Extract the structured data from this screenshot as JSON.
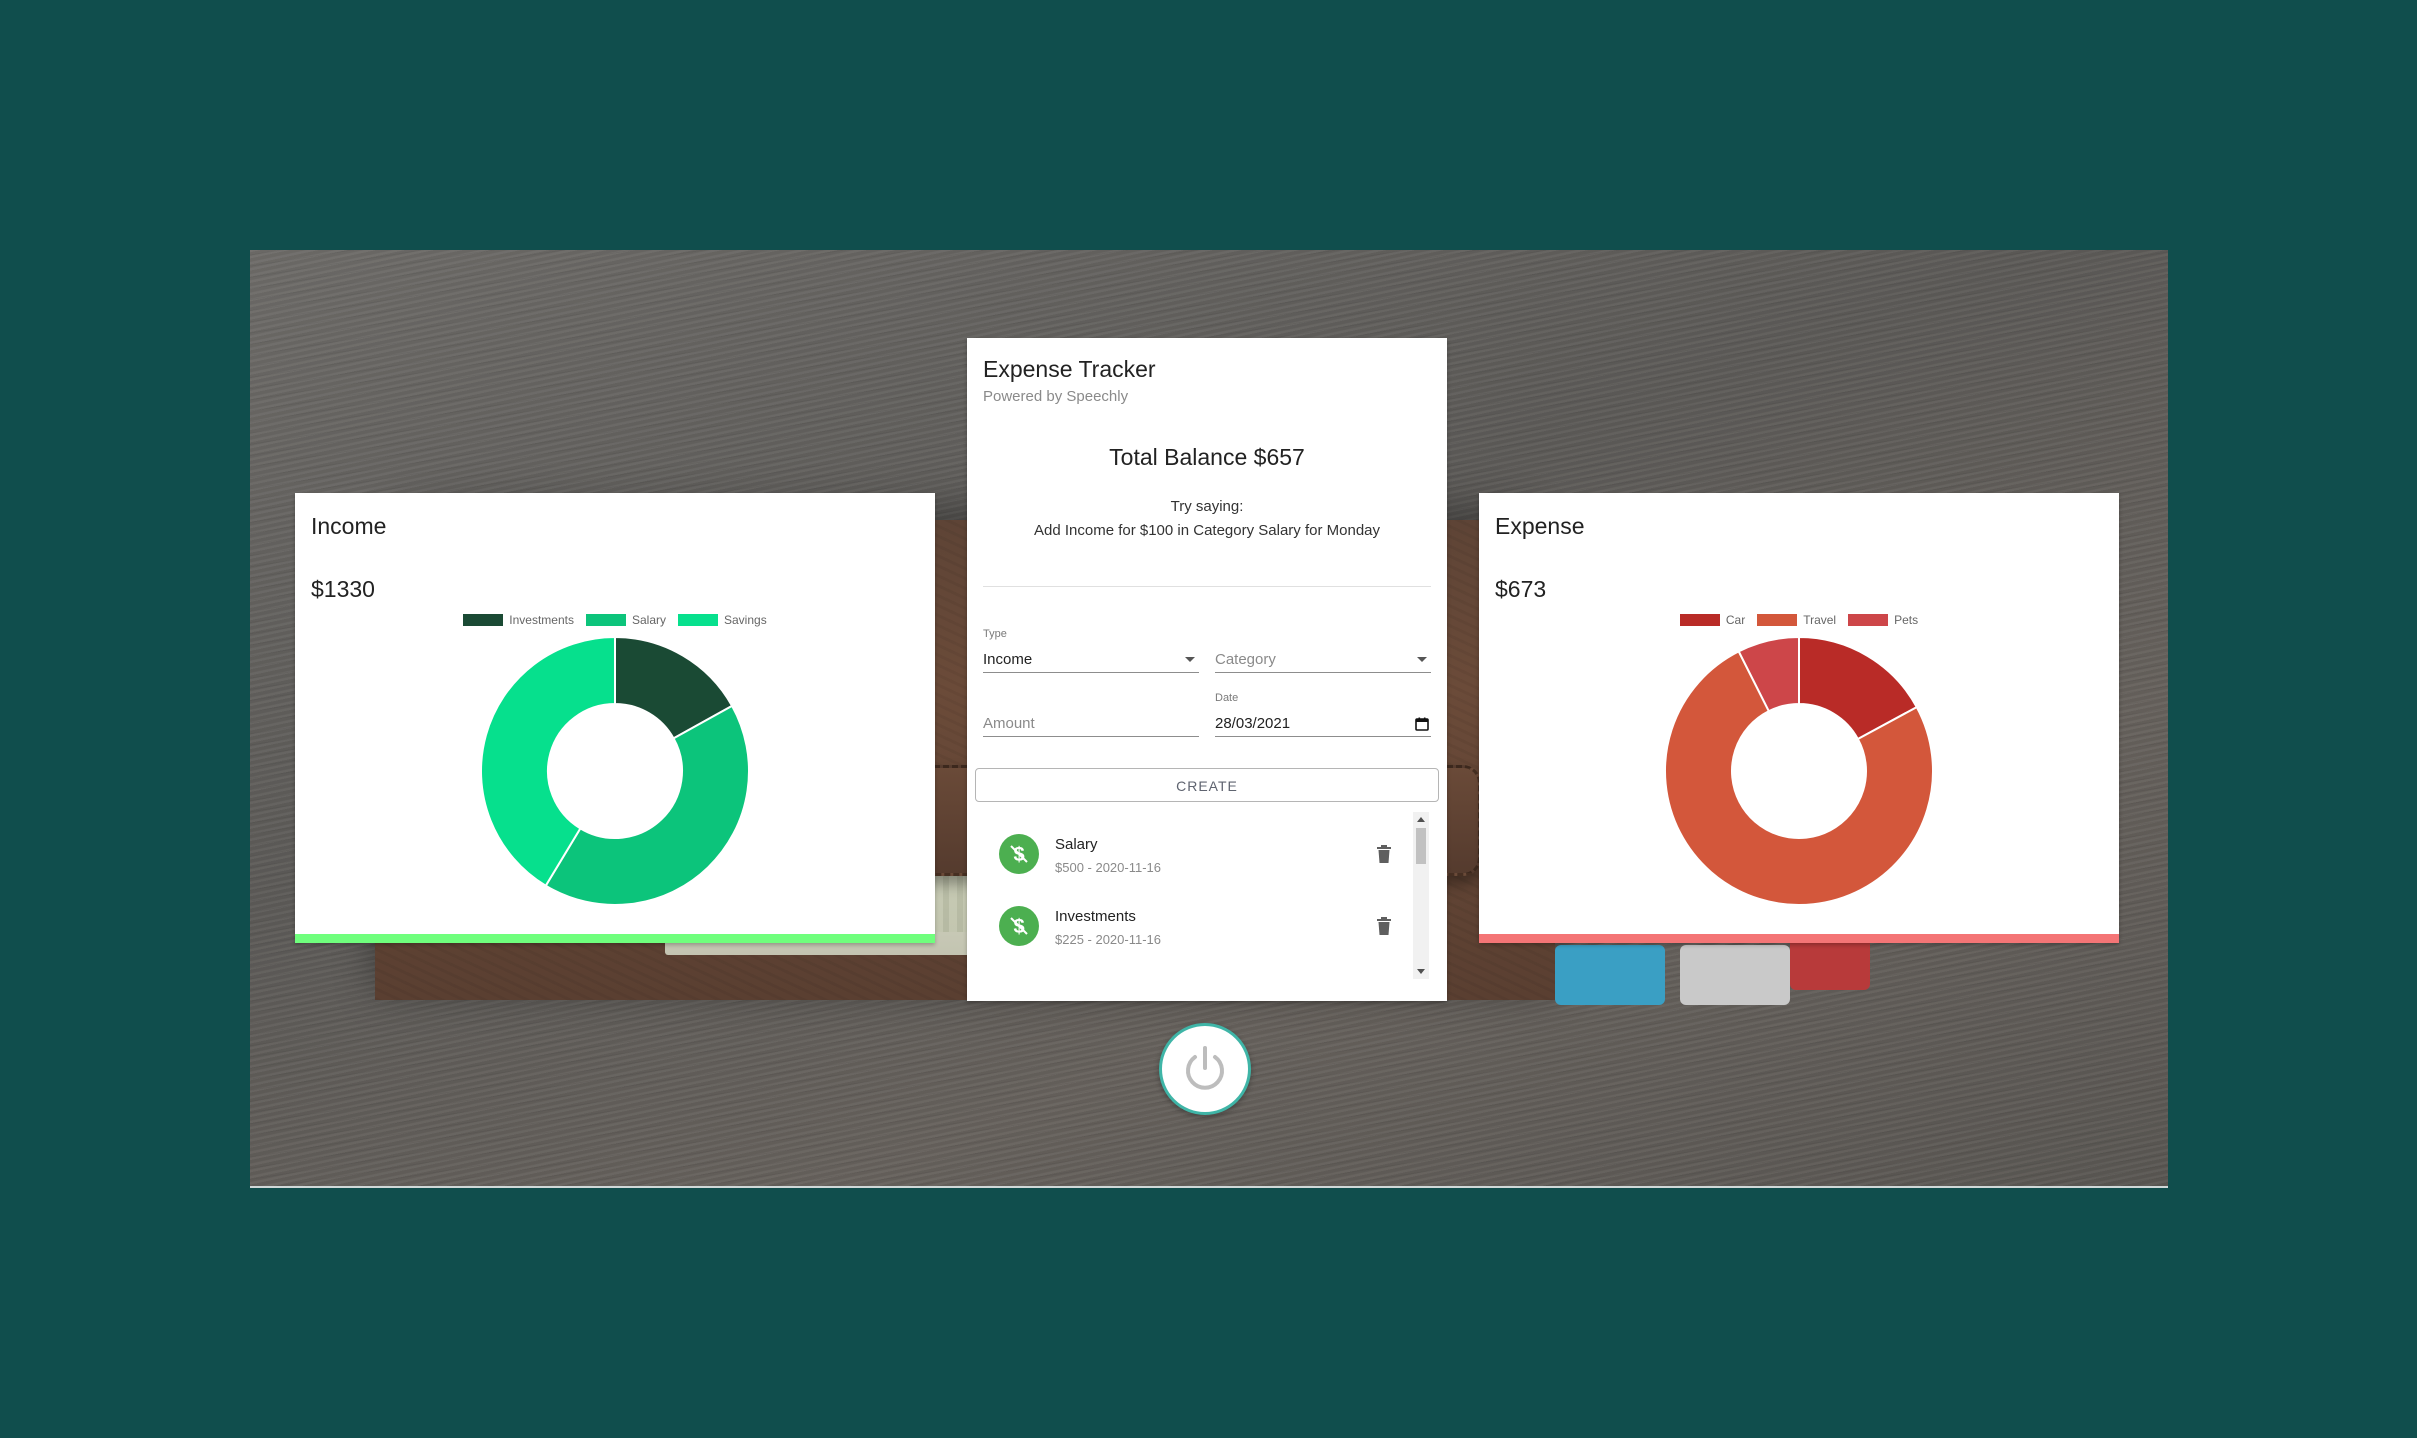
{
  "income": {
    "title": "Income",
    "amount": "$1330",
    "accent": "#6fff7d",
    "legend": [
      {
        "label": "Investments",
        "color": "#1a4a34"
      },
      {
        "label": "Salary",
        "color": "#0cc47b"
      },
      {
        "label": "Savings",
        "color": "#06e08d"
      }
    ]
  },
  "expense": {
    "title": "Expense",
    "amount": "$673",
    "accent": "#f47576",
    "legend": [
      {
        "label": "Car",
        "color": "#b92b27"
      },
      {
        "label": "Travel",
        "color": "#d3573b"
      },
      {
        "label": "Pets",
        "color": "#cd4649"
      }
    ]
  },
  "chart_data": [
    {
      "type": "pie",
      "title": "",
      "categories": [
        "Investments",
        "Salary",
        "Savings"
      ],
      "values": [
        225,
        555,
        550
      ],
      "colors": [
        "#1a4a34",
        "#0cc47b",
        "#06e08d"
      ]
    },
    {
      "type": "pie",
      "title": "",
      "categories": [
        "Car",
        "Travel",
        "Pets"
      ],
      "values": [
        115,
        508,
        50
      ],
      "colors": [
        "#b92b27",
        "#d3573b",
        "#cd4649"
      ]
    }
  ],
  "tracker": {
    "title": "Expense Tracker",
    "subtitle": "Powered by Speechly",
    "balance": "Total Balance $657",
    "try_line1": "Try saying:",
    "try_line2": "Add Income for $100 in Category Salary for Monday",
    "type_label": "Type",
    "type_value": "Income",
    "category_placeholder": "Category",
    "amount_placeholder": "Amount",
    "date_label": "Date",
    "date_value": "28/03/2021",
    "create_label": "CREATE",
    "transactions": [
      {
        "title": "Salary",
        "subtitle": "$500 - 2020-11-16"
      },
      {
        "title": "Investments",
        "subtitle": "$225 - 2020-11-16"
      }
    ],
    "avatar_color": "#4caf50"
  },
  "icons": {
    "avatar": "dollar-off-icon",
    "delete": "trash-icon",
    "mic": "power-icon",
    "date": "calendar-icon",
    "dropdown": "caret-down-icon"
  }
}
